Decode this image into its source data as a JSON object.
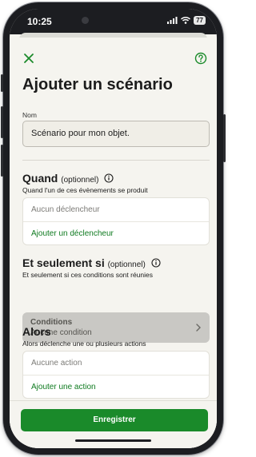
{
  "status_bar": {
    "time": "10:25",
    "battery": "77"
  },
  "header": {
    "title": "Ajouter un scénario"
  },
  "name_field": {
    "label": "Nom",
    "value": "Scénario pour mon objet."
  },
  "when": {
    "title": "Quand",
    "optional": "(optionnel)",
    "subtitle": "Quand l'un de ces évènements se produit",
    "empty": "Aucun déclencheur",
    "add": "Ajouter un déclencheur"
  },
  "if": {
    "title": "Et seulement si",
    "optional": "(optionnel)",
    "subtitle": "Et seulement si ces conditions sont réunies",
    "conditions_title": "Conditions",
    "conditions_value": "Aucune condition"
  },
  "then": {
    "title": "Alors",
    "subtitle": "Alors déclenche une ou plusieurs actions",
    "empty": "Aucune action",
    "add": "Ajouter une action"
  },
  "footer": {
    "save_label": "Enregistrer"
  },
  "colors": {
    "accent": "#1a8a2a",
    "link": "#0e7a1f",
    "background": "#f5f4ef",
    "disabled": "#c9c8c4"
  }
}
